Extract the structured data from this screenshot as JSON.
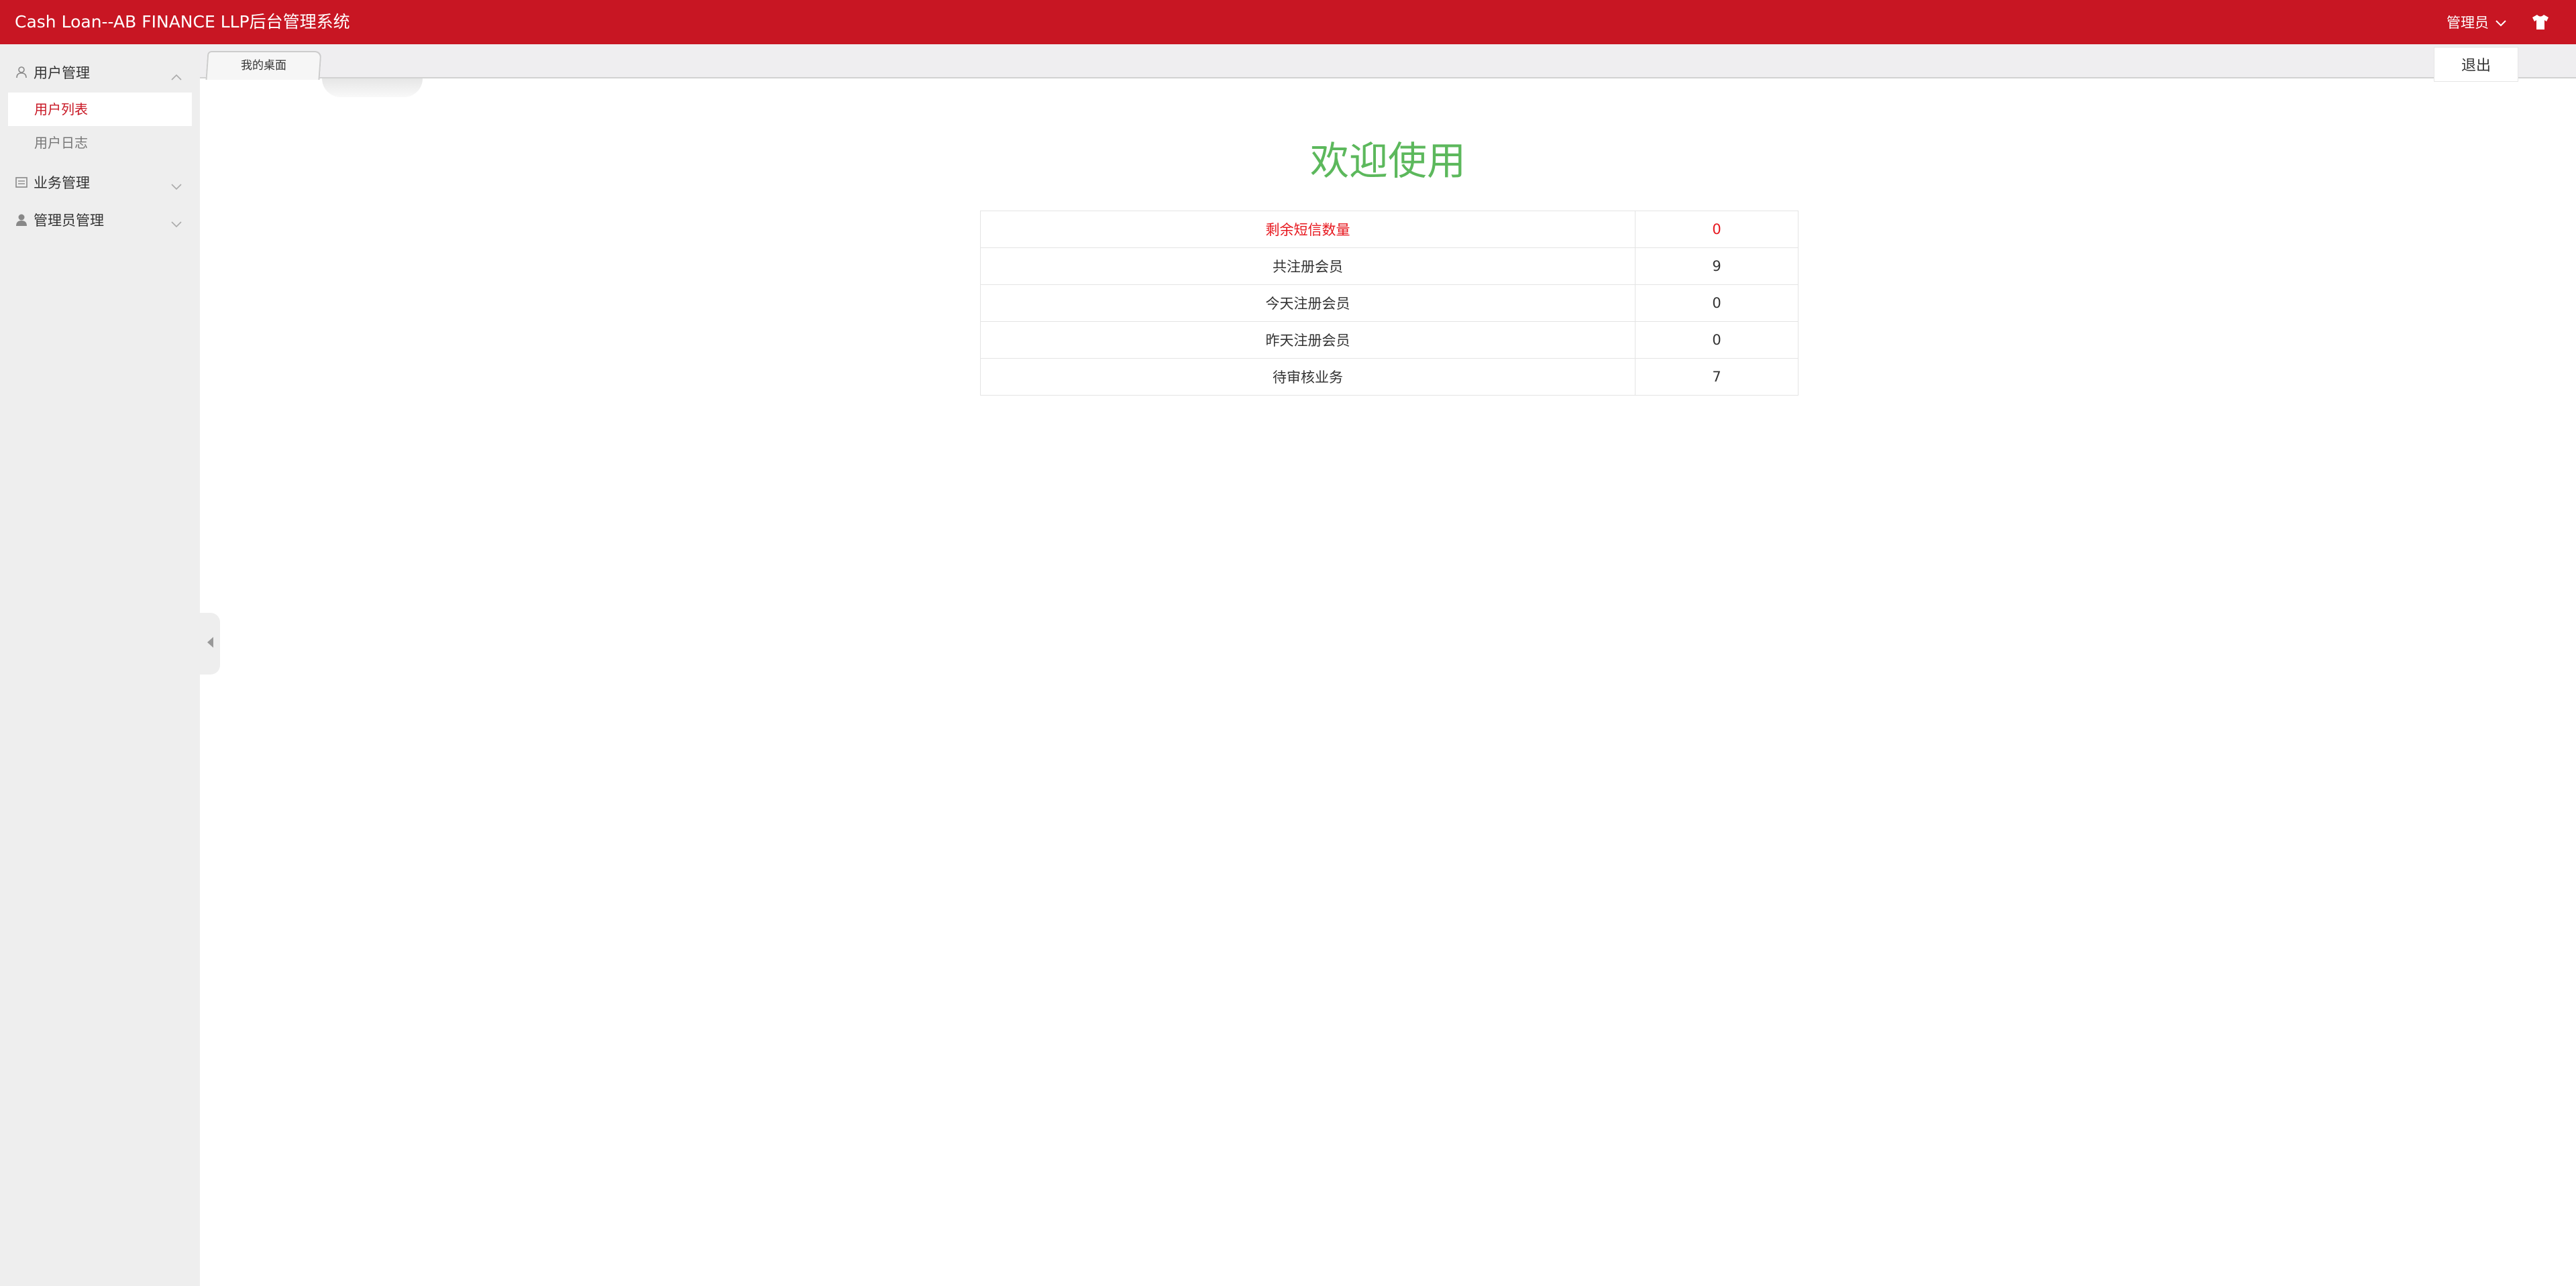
{
  "header": {
    "title": "Cash Loan--AB FINANCE LLP后台管理系统",
    "admin_label": "管理员",
    "background": "#c81623"
  },
  "sidebar": {
    "groups": [
      {
        "label": "用户管理",
        "icon": "user-outline-icon",
        "expanded": true,
        "items": [
          {
            "label": "用户列表",
            "active": true
          },
          {
            "label": "用户日志",
            "active": false
          }
        ]
      },
      {
        "label": "业务管理",
        "icon": "business-icon",
        "expanded": false
      },
      {
        "label": "管理员管理",
        "icon": "admin-icon",
        "expanded": false
      }
    ]
  },
  "tabs": [
    {
      "label": "我的桌面",
      "active": true
    }
  ],
  "logout_label": "退出",
  "main": {
    "welcome": "欢迎使用",
    "welcome_color": "#5cb85c",
    "stats": [
      {
        "label": "剩余短信数量",
        "value": "0",
        "highlight": true
      },
      {
        "label": "共注册会员",
        "value": "9"
      },
      {
        "label": "今天注册会员",
        "value": "0"
      },
      {
        "label": "昨天注册会员",
        "value": "0"
      },
      {
        "label": "待审核业务",
        "value": "7"
      }
    ],
    "highlight_color": "#e7181f"
  }
}
